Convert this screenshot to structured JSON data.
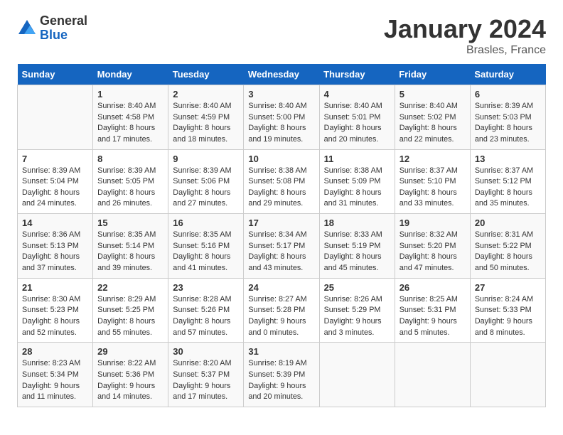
{
  "logo": {
    "general": "General",
    "blue": "Blue"
  },
  "title": "January 2024",
  "subtitle": "Brasles, France",
  "days_header": [
    "Sunday",
    "Monday",
    "Tuesday",
    "Wednesday",
    "Thursday",
    "Friday",
    "Saturday"
  ],
  "weeks": [
    [
      {
        "day": "",
        "sunrise": "",
        "sunset": "",
        "daylight": ""
      },
      {
        "day": "1",
        "sunrise": "Sunrise: 8:40 AM",
        "sunset": "Sunset: 4:58 PM",
        "daylight": "Daylight: 8 hours and 17 minutes."
      },
      {
        "day": "2",
        "sunrise": "Sunrise: 8:40 AM",
        "sunset": "Sunset: 4:59 PM",
        "daylight": "Daylight: 8 hours and 18 minutes."
      },
      {
        "day": "3",
        "sunrise": "Sunrise: 8:40 AM",
        "sunset": "Sunset: 5:00 PM",
        "daylight": "Daylight: 8 hours and 19 minutes."
      },
      {
        "day": "4",
        "sunrise": "Sunrise: 8:40 AM",
        "sunset": "Sunset: 5:01 PM",
        "daylight": "Daylight: 8 hours and 20 minutes."
      },
      {
        "day": "5",
        "sunrise": "Sunrise: 8:40 AM",
        "sunset": "Sunset: 5:02 PM",
        "daylight": "Daylight: 8 hours and 22 minutes."
      },
      {
        "day": "6",
        "sunrise": "Sunrise: 8:39 AM",
        "sunset": "Sunset: 5:03 PM",
        "daylight": "Daylight: 8 hours and 23 minutes."
      }
    ],
    [
      {
        "day": "7",
        "sunrise": "Sunrise: 8:39 AM",
        "sunset": "Sunset: 5:04 PM",
        "daylight": "Daylight: 8 hours and 24 minutes."
      },
      {
        "day": "8",
        "sunrise": "Sunrise: 8:39 AM",
        "sunset": "Sunset: 5:05 PM",
        "daylight": "Daylight: 8 hours and 26 minutes."
      },
      {
        "day": "9",
        "sunrise": "Sunrise: 8:39 AM",
        "sunset": "Sunset: 5:06 PM",
        "daylight": "Daylight: 8 hours and 27 minutes."
      },
      {
        "day": "10",
        "sunrise": "Sunrise: 8:38 AM",
        "sunset": "Sunset: 5:08 PM",
        "daylight": "Daylight: 8 hours and 29 minutes."
      },
      {
        "day": "11",
        "sunrise": "Sunrise: 8:38 AM",
        "sunset": "Sunset: 5:09 PM",
        "daylight": "Daylight: 8 hours and 31 minutes."
      },
      {
        "day": "12",
        "sunrise": "Sunrise: 8:37 AM",
        "sunset": "Sunset: 5:10 PM",
        "daylight": "Daylight: 8 hours and 33 minutes."
      },
      {
        "day": "13",
        "sunrise": "Sunrise: 8:37 AM",
        "sunset": "Sunset: 5:12 PM",
        "daylight": "Daylight: 8 hours and 35 minutes."
      }
    ],
    [
      {
        "day": "14",
        "sunrise": "Sunrise: 8:36 AM",
        "sunset": "Sunset: 5:13 PM",
        "daylight": "Daylight: 8 hours and 37 minutes."
      },
      {
        "day": "15",
        "sunrise": "Sunrise: 8:35 AM",
        "sunset": "Sunset: 5:14 PM",
        "daylight": "Daylight: 8 hours and 39 minutes."
      },
      {
        "day": "16",
        "sunrise": "Sunrise: 8:35 AM",
        "sunset": "Sunset: 5:16 PM",
        "daylight": "Daylight: 8 hours and 41 minutes."
      },
      {
        "day": "17",
        "sunrise": "Sunrise: 8:34 AM",
        "sunset": "Sunset: 5:17 PM",
        "daylight": "Daylight: 8 hours and 43 minutes."
      },
      {
        "day": "18",
        "sunrise": "Sunrise: 8:33 AM",
        "sunset": "Sunset: 5:19 PM",
        "daylight": "Daylight: 8 hours and 45 minutes."
      },
      {
        "day": "19",
        "sunrise": "Sunrise: 8:32 AM",
        "sunset": "Sunset: 5:20 PM",
        "daylight": "Daylight: 8 hours and 47 minutes."
      },
      {
        "day": "20",
        "sunrise": "Sunrise: 8:31 AM",
        "sunset": "Sunset: 5:22 PM",
        "daylight": "Daylight: 8 hours and 50 minutes."
      }
    ],
    [
      {
        "day": "21",
        "sunrise": "Sunrise: 8:30 AM",
        "sunset": "Sunset: 5:23 PM",
        "daylight": "Daylight: 8 hours and 52 minutes."
      },
      {
        "day": "22",
        "sunrise": "Sunrise: 8:29 AM",
        "sunset": "Sunset: 5:25 PM",
        "daylight": "Daylight: 8 hours and 55 minutes."
      },
      {
        "day": "23",
        "sunrise": "Sunrise: 8:28 AM",
        "sunset": "Sunset: 5:26 PM",
        "daylight": "Daylight: 8 hours and 57 minutes."
      },
      {
        "day": "24",
        "sunrise": "Sunrise: 8:27 AM",
        "sunset": "Sunset: 5:28 PM",
        "daylight": "Daylight: 9 hours and 0 minutes."
      },
      {
        "day": "25",
        "sunrise": "Sunrise: 8:26 AM",
        "sunset": "Sunset: 5:29 PM",
        "daylight": "Daylight: 9 hours and 3 minutes."
      },
      {
        "day": "26",
        "sunrise": "Sunrise: 8:25 AM",
        "sunset": "Sunset: 5:31 PM",
        "daylight": "Daylight: 9 hours and 5 minutes."
      },
      {
        "day": "27",
        "sunrise": "Sunrise: 8:24 AM",
        "sunset": "Sunset: 5:33 PM",
        "daylight": "Daylight: 9 hours and 8 minutes."
      }
    ],
    [
      {
        "day": "28",
        "sunrise": "Sunrise: 8:23 AM",
        "sunset": "Sunset: 5:34 PM",
        "daylight": "Daylight: 9 hours and 11 minutes."
      },
      {
        "day": "29",
        "sunrise": "Sunrise: 8:22 AM",
        "sunset": "Sunset: 5:36 PM",
        "daylight": "Daylight: 9 hours and 14 minutes."
      },
      {
        "day": "30",
        "sunrise": "Sunrise: 8:20 AM",
        "sunset": "Sunset: 5:37 PM",
        "daylight": "Daylight: 9 hours and 17 minutes."
      },
      {
        "day": "31",
        "sunrise": "Sunrise: 8:19 AM",
        "sunset": "Sunset: 5:39 PM",
        "daylight": "Daylight: 9 hours and 20 minutes."
      },
      {
        "day": "",
        "sunrise": "",
        "sunset": "",
        "daylight": ""
      },
      {
        "day": "",
        "sunrise": "",
        "sunset": "",
        "daylight": ""
      },
      {
        "day": "",
        "sunrise": "",
        "sunset": "",
        "daylight": ""
      }
    ]
  ]
}
